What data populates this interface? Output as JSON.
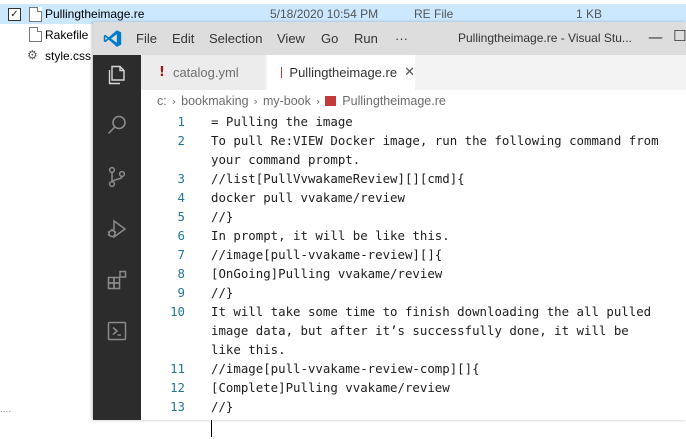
{
  "explorer": {
    "selected_file": {
      "name": "Pullingtheimage.re",
      "date": "5/18/2020 10:54 PM",
      "type": "RE File",
      "size": "1 KB",
      "checked_mark": "✓"
    },
    "files": [
      {
        "name": "Rakefile"
      },
      {
        "name": "style.css"
      }
    ],
    "left_stub": "...."
  },
  "window": {
    "menu": [
      "File",
      "Edit",
      "Selection",
      "View",
      "Go",
      "Run",
      "···"
    ],
    "title": "Pullingtheimage.re - Visual Stu...",
    "minimize": "—",
    "maximize": "☐",
    "accent": "#0065a9"
  },
  "activity_icons": [
    "explorer-icon",
    "search-icon",
    "source-control-icon",
    "run-debug-icon",
    "extensions-icon",
    "remote-icon"
  ],
  "tabs": [
    {
      "label": "catalog.yml",
      "marker": "!"
    },
    {
      "label": "Pullingtheimage.re",
      "close": "✕"
    }
  ],
  "breadcrumb": [
    "c:",
    "bookmaking",
    "my-book",
    "Pullingtheimage.re"
  ],
  "breadcrumb_sep": "›",
  "editor": {
    "lines": [
      {
        "num": "1",
        "text": "= Pulling the image"
      },
      {
        "num": "2",
        "text": "To pull Re:VIEW Docker image, run the following command from"
      },
      {
        "num": "",
        "text": "your command prompt."
      },
      {
        "num": "3",
        "text": "//list[PullVvwakameReview][][cmd]{"
      },
      {
        "num": "4",
        "text": "docker pull vvakame/review"
      },
      {
        "num": "5",
        "text": "//}"
      },
      {
        "num": "6",
        "text": "In prompt, it will be like this."
      },
      {
        "num": "7",
        "text": "//image[pull-vvakame-review][]{"
      },
      {
        "num": "8",
        "text": "[OnGoing]Pulling vvakame/review"
      },
      {
        "num": "9",
        "text": "//}"
      },
      {
        "num": "10",
        "text": "It will take some time to finish downloading the all pulled"
      },
      {
        "num": "",
        "text": "image data, but after it’s successfully done, it will be"
      },
      {
        "num": "",
        "text": "like this."
      },
      {
        "num": "11",
        "text": "//image[pull-vvakame-review-comp][]{"
      },
      {
        "num": "12",
        "text": "[Complete]Pulling vvakame/review"
      },
      {
        "num": "13",
        "text": "//}"
      }
    ]
  }
}
